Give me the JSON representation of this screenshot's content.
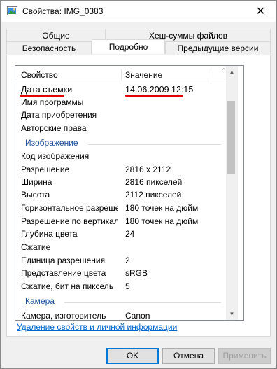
{
  "window": {
    "title": "Свойства: IMG_0383",
    "close_symbol": "✕"
  },
  "tabs_row1": [
    {
      "label": "Общие"
    },
    {
      "label": "Хеш-суммы файлов"
    }
  ],
  "tabs_row2": [
    {
      "label": "Безопасность"
    },
    {
      "label": "Подробно"
    },
    {
      "label": "Предыдущие версии"
    }
  ],
  "list": {
    "header": {
      "property": "Свойство",
      "value": "Значение"
    },
    "rows": [
      {
        "type": "item",
        "name": "Дата съемки",
        "value": "14.06.2009 12:15"
      },
      {
        "type": "item",
        "name": "Имя программы",
        "value": ""
      },
      {
        "type": "item",
        "name": "Дата приобретения",
        "value": ""
      },
      {
        "type": "item",
        "name": "Авторские права",
        "value": ""
      },
      {
        "type": "group",
        "name": "Изображение"
      },
      {
        "type": "item",
        "name": "Код изображения",
        "value": ""
      },
      {
        "type": "item",
        "name": "Разрешение",
        "value": "2816 x 2112"
      },
      {
        "type": "item",
        "name": "Ширина",
        "value": "2816 пикселей"
      },
      {
        "type": "item",
        "name": "Высота",
        "value": "2112 пикселей"
      },
      {
        "type": "item",
        "name": "Горизонтальное разрешение",
        "value": "180 точек на дюйм"
      },
      {
        "type": "item",
        "name": "Разрешение по вертикали",
        "value": "180 точек на дюйм"
      },
      {
        "type": "item",
        "name": "Глубина цвета",
        "value": "24"
      },
      {
        "type": "item",
        "name": "Сжатие",
        "value": ""
      },
      {
        "type": "item",
        "name": "Единица разрешения",
        "value": "2"
      },
      {
        "type": "item",
        "name": "Представление цвета",
        "value": "sRGB"
      },
      {
        "type": "item",
        "name": "Сжатие, бит на пиксель",
        "value": "5"
      },
      {
        "type": "group",
        "name": "Камера"
      },
      {
        "type": "item",
        "name": "Камера, изготовитель",
        "value": "Canon"
      }
    ]
  },
  "remove_link": "Удаление свойств и личной информации",
  "buttons": {
    "ok": "OK",
    "cancel": "Отмена",
    "apply": "Применить"
  },
  "colors": {
    "group_text": "#1e4e9a",
    "link": "#0066cc",
    "annotation": "#e00000",
    "accent": "#0078d7"
  }
}
